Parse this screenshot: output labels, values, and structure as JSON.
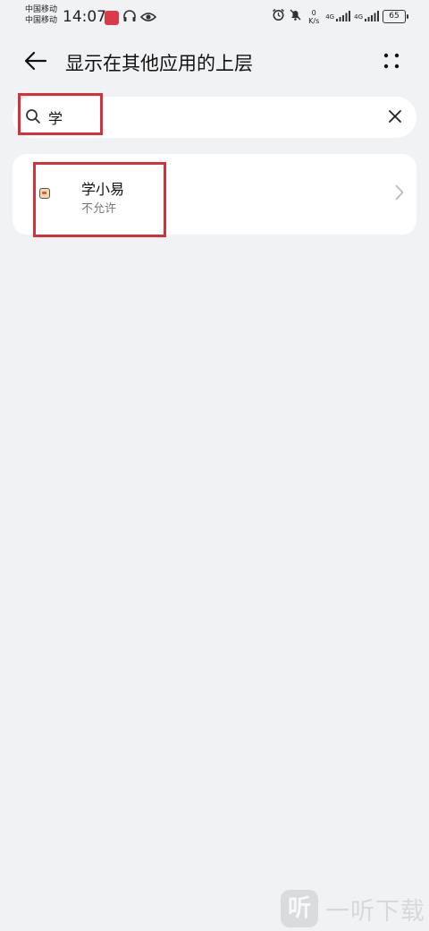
{
  "status_bar": {
    "carrier_1": "中国移动",
    "carrier_2": "中国移动",
    "time": "14:07",
    "net_speed_value": "0",
    "net_speed_unit": "K/s",
    "signal_1_label": "4G",
    "signal_2_label": "4G",
    "battery_level": "65",
    "icons": [
      "app-badge",
      "headphones-icon",
      "eye-icon",
      "alarm-icon",
      "mute-icon",
      "signal-icon",
      "signal-icon",
      "battery-icon"
    ]
  },
  "header": {
    "title": "显示在其他应用的上层",
    "back_icon": "back-arrow-icon",
    "more_icon": "more-dots-icon"
  },
  "search": {
    "value": "学",
    "icon": "search-icon",
    "clear_icon": "close-icon"
  },
  "apps": [
    {
      "name": "学小易",
      "status": "不允许"
    }
  ],
  "watermark": {
    "logo_char": "听",
    "text": "一听下载"
  },
  "colors": {
    "background": "#f1f2f4",
    "card": "#ffffff",
    "highlight": "#d6303b",
    "secondary_text": "#777777"
  }
}
